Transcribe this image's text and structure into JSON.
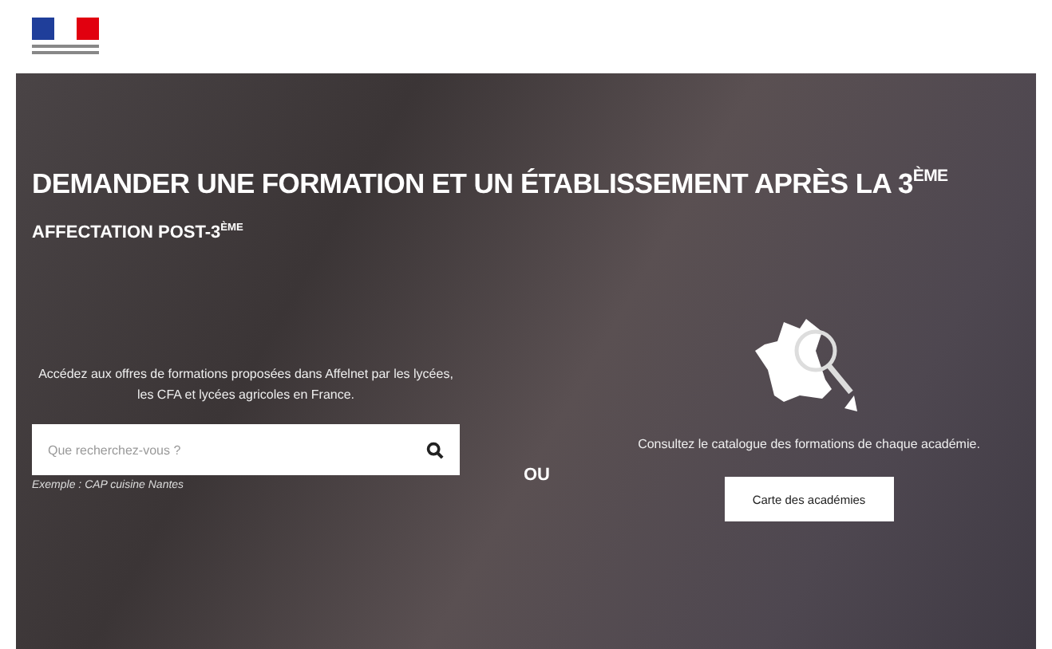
{
  "hero": {
    "title": "DEMANDER UNE FORMATION ET UN ÉTABLISSEMENT APRÈS LA 3$^{ÈME}$",
    "subtitle": "AFFECTATION POST-3$^{ÈME}$",
    "left": {
      "intro": "Accédez aux offres de formations proposées dans Affelnet par les lycées, les CFA et lycées agricoles en France.",
      "search": {
        "placeholder": "Que recherchez-vous ?"
      },
      "example": "Exemple : CAP cuisine Nantes"
    },
    "separator": "OU",
    "right": {
      "text": "Consultez le catalogue des formations de chaque académie.",
      "button": "Carte des académies"
    }
  }
}
